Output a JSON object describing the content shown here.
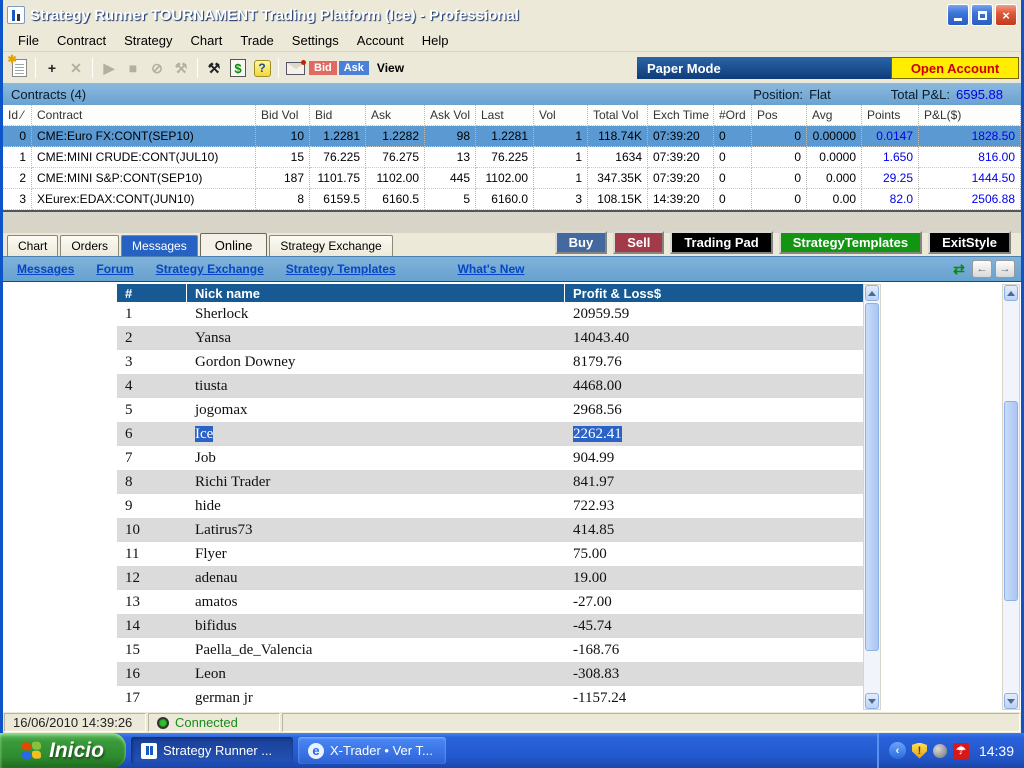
{
  "colors": {
    "titlebar_blue": "#1658cc",
    "panel_blue": "#6aa2d0",
    "board_header_blue": "#175a93",
    "selected_row_blue": "#5b99d2",
    "value_blue": "#0000e8",
    "link_blue": "#0646c6",
    "buy_bg": "#44699e",
    "sell_bg": "#a23a48",
    "trading_pad_bg": "#000000",
    "strategy_templates_bg": "#129612",
    "exit_style_bg": "#000000",
    "open_account_bg": "#ffee00",
    "open_account_text": "#cc0000",
    "taskbar_blue": "#2258cc",
    "start_green": "#2e8a2e",
    "connected_green": "#1a8a1a"
  },
  "window": {
    "title": "Strategy Runner TOURNAMENT Trading Platform (Ice) - Professional",
    "minimize": "minimize",
    "maximize": "maximize",
    "close": "×"
  },
  "menu": {
    "items": [
      {
        "label": "File"
      },
      {
        "label": "Contract"
      },
      {
        "label": "Strategy"
      },
      {
        "label": "Chart"
      },
      {
        "label": "Trade"
      },
      {
        "label": "Settings"
      },
      {
        "label": "Account"
      },
      {
        "label": "Help"
      }
    ]
  },
  "toolbar": {
    "icons": [
      {
        "name": "add-icon",
        "glyph": "+",
        "enabled": true
      },
      {
        "name": "delete-icon",
        "glyph": "✕",
        "enabled": false
      },
      {
        "name": "play-icon",
        "glyph": "▶",
        "enabled": false
      },
      {
        "name": "stop-icon",
        "glyph": "■",
        "enabled": false
      },
      {
        "name": "cancel-icon",
        "glyph": "⊘",
        "enabled": false
      },
      {
        "name": "gavel-icon",
        "glyph": "⚒",
        "enabled": false
      },
      {
        "name": "tools-icon",
        "glyph": "⚒",
        "enabled": true
      }
    ],
    "bid_label": "Bid",
    "ask_label": "Ask",
    "view_label": "View",
    "paper_mode_label": "Paper Mode",
    "open_account_label": "Open Account"
  },
  "contracts": {
    "panel_title": "Contracts (4)",
    "position_label": "Position:",
    "position_value": "Flat",
    "total_pl_label": "Total P&L:",
    "total_pl_value": "6595.88",
    "columns": [
      "Id ⁄",
      "Contract",
      "Bid Vol",
      "Bid",
      "Ask",
      "Ask Vol",
      "Last",
      "Vol",
      "Total Vol",
      "Exch Time",
      "#Ord",
      "Pos",
      "Avg",
      "Points",
      "P&L($)"
    ],
    "rows": [
      {
        "id": "0",
        "contract": "CME:Euro FX:CONT(SEP10)",
        "bid_vol": "10",
        "bid": "1.2281",
        "ask": "1.2282",
        "ask_vol": "98",
        "last": "1.2281",
        "vol": "1",
        "total_vol": "118.74K",
        "exch_time": "07:39:20",
        "ord": "0",
        "pos": "0",
        "avg": "0.00000",
        "points": "0.0147",
        "pl": "1828.50",
        "selected": true
      },
      {
        "id": "1",
        "contract": "CME:MINI CRUDE:CONT(JUL10)",
        "bid_vol": "15",
        "bid": "76.225",
        "ask": "76.275",
        "ask_vol": "13",
        "last": "76.225",
        "vol": "1",
        "total_vol": "1634",
        "exch_time": "07:39:20",
        "ord": "0",
        "pos": "0",
        "avg": "0.0000",
        "points": "1.650",
        "pl": "816.00",
        "selected": false
      },
      {
        "id": "2",
        "contract": "CME:MINI S&P:CONT(SEP10)",
        "bid_vol": "187",
        "bid": "1101.75",
        "ask": "1102.00",
        "ask_vol": "445",
        "last": "1102.00",
        "vol": "1",
        "total_vol": "347.35K",
        "exch_time": "07:39:20",
        "ord": "0",
        "pos": "0",
        "avg": "0.000",
        "points": "29.25",
        "pl": "1444.50",
        "selected": false
      },
      {
        "id": "3",
        "contract": "XEurex:EDAX:CONT(JUN10)",
        "bid_vol": "8",
        "bid": "6159.5",
        "ask": "6160.5",
        "ask_vol": "5",
        "last": "6160.0",
        "vol": "3",
        "total_vol": "108.15K",
        "exch_time": "14:39:20",
        "ord": "0",
        "pos": "0",
        "avg": "0.00",
        "points": "82.0",
        "pl": "2506.88",
        "selected": false
      }
    ]
  },
  "tabs": {
    "items": [
      {
        "label": "Chart",
        "highlighted": false,
        "active": false
      },
      {
        "label": "Orders",
        "highlighted": false,
        "active": false
      },
      {
        "label": "Messages",
        "highlighted": true,
        "active": false
      },
      {
        "label": "Online",
        "highlighted": false,
        "active": true
      },
      {
        "label": "Strategy Exchange",
        "highlighted": false,
        "active": false
      }
    ]
  },
  "actions": [
    {
      "label": "Buy",
      "variant": "buy"
    },
    {
      "label": "Sell",
      "variant": "sell"
    },
    {
      "label": "Trading Pad",
      "variant": "pad"
    },
    {
      "label": "StrategyTemplates",
      "variant": "tmpl"
    },
    {
      "label": "ExitStyle",
      "variant": "exit"
    }
  ],
  "linkbar": {
    "links": [
      {
        "label": "Messages"
      },
      {
        "label": "Forum"
      },
      {
        "label": "Strategy Exchange"
      },
      {
        "label": "Strategy Templates"
      },
      {
        "label": "What's New"
      }
    ]
  },
  "leaderboard": {
    "columns": [
      "#",
      "Nick name",
      "Profit & Loss$"
    ],
    "rows": [
      {
        "rank": "1",
        "nick": "Sherlock",
        "pl": "20959.59",
        "selected": false
      },
      {
        "rank": "2",
        "nick": "Yansa",
        "pl": "14043.40",
        "selected": false
      },
      {
        "rank": "3",
        "nick": "Gordon Downey",
        "pl": "8179.76",
        "selected": false
      },
      {
        "rank": "4",
        "nick": "tiusta",
        "pl": "4468.00",
        "selected": false
      },
      {
        "rank": "5",
        "nick": "jogomax",
        "pl": "2968.56",
        "selected": false
      },
      {
        "rank": "6",
        "nick": "Ice",
        "pl": "2262.41",
        "selected": true
      },
      {
        "rank": "7",
        "nick": "Job",
        "pl": "904.99",
        "selected": false
      },
      {
        "rank": "8",
        "nick": "Richi Trader",
        "pl": "841.97",
        "selected": false
      },
      {
        "rank": "9",
        "nick": "hide",
        "pl": "722.93",
        "selected": false
      },
      {
        "rank": "10",
        "nick": "Latirus73",
        "pl": "414.85",
        "selected": false
      },
      {
        "rank": "11",
        "nick": "Flyer",
        "pl": "75.00",
        "selected": false
      },
      {
        "rank": "12",
        "nick": "adenau",
        "pl": "19.00",
        "selected": false
      },
      {
        "rank": "13",
        "nick": "amatos",
        "pl": "-27.00",
        "selected": false
      },
      {
        "rank": "14",
        "nick": "bifidus",
        "pl": "-45.74",
        "selected": false
      },
      {
        "rank": "15",
        "nick": "Paella_de_Valencia",
        "pl": "-168.76",
        "selected": false
      },
      {
        "rank": "16",
        "nick": "Leon",
        "pl": "-308.83",
        "selected": false
      },
      {
        "rank": "17",
        "nick": "german jr",
        "pl": "-1157.24",
        "selected": false
      }
    ]
  },
  "statusbar": {
    "datetime": "16/06/2010 14:39:26",
    "connection": "Connected"
  },
  "taskbar": {
    "start_label": "Inicio",
    "tasks": [
      {
        "label": "Strategy Runner ...",
        "active": true
      },
      {
        "label": "X-Trader • Ver T...",
        "active": false
      }
    ],
    "time": "14:39"
  }
}
